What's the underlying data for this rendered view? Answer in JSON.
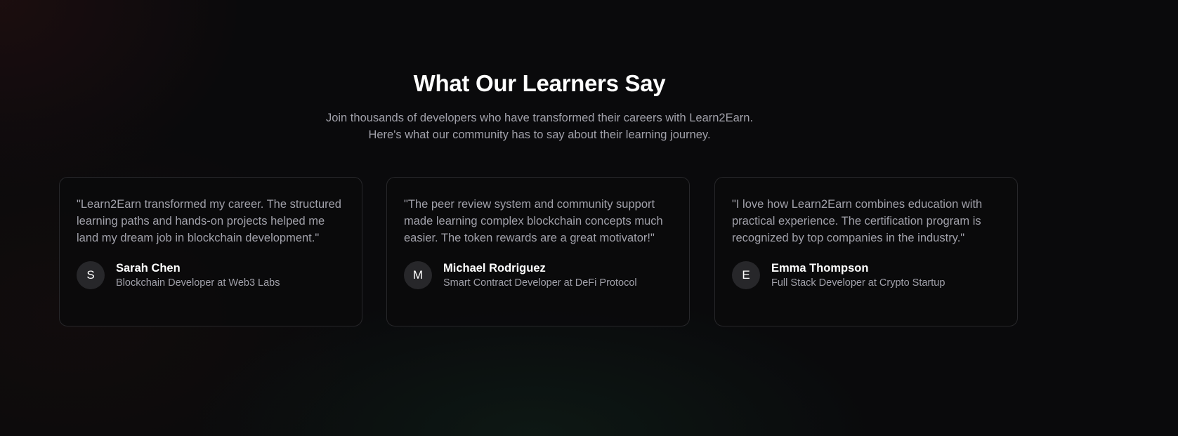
{
  "header": {
    "title": "What Our Learners Say",
    "subtitle_line1": "Join thousands of developers who have transformed their careers with Learn2Earn.",
    "subtitle_line2": "Here's what our community has to say about their learning journey."
  },
  "testimonials": [
    {
      "quote": "\"Learn2Earn transformed my career. The structured learning paths and hands-on projects helped me land my dream job in blockchain development.\"",
      "initial": "S",
      "name": "Sarah Chen",
      "role": "Blockchain Developer at Web3 Labs"
    },
    {
      "quote": "\"The peer review system and community support made learning complex blockchain concepts much easier. The token rewards are a great motivator!\"",
      "initial": "M",
      "name": "Michael Rodriguez",
      "role": "Smart Contract Developer at DeFi Protocol"
    },
    {
      "quote": "\"I love how Learn2Earn combines education with practical experience. The certification program is recognized by top companies in the industry.\"",
      "initial": "E",
      "name": "Emma Thompson",
      "role": "Full Stack Developer at Crypto Startup"
    }
  ]
}
